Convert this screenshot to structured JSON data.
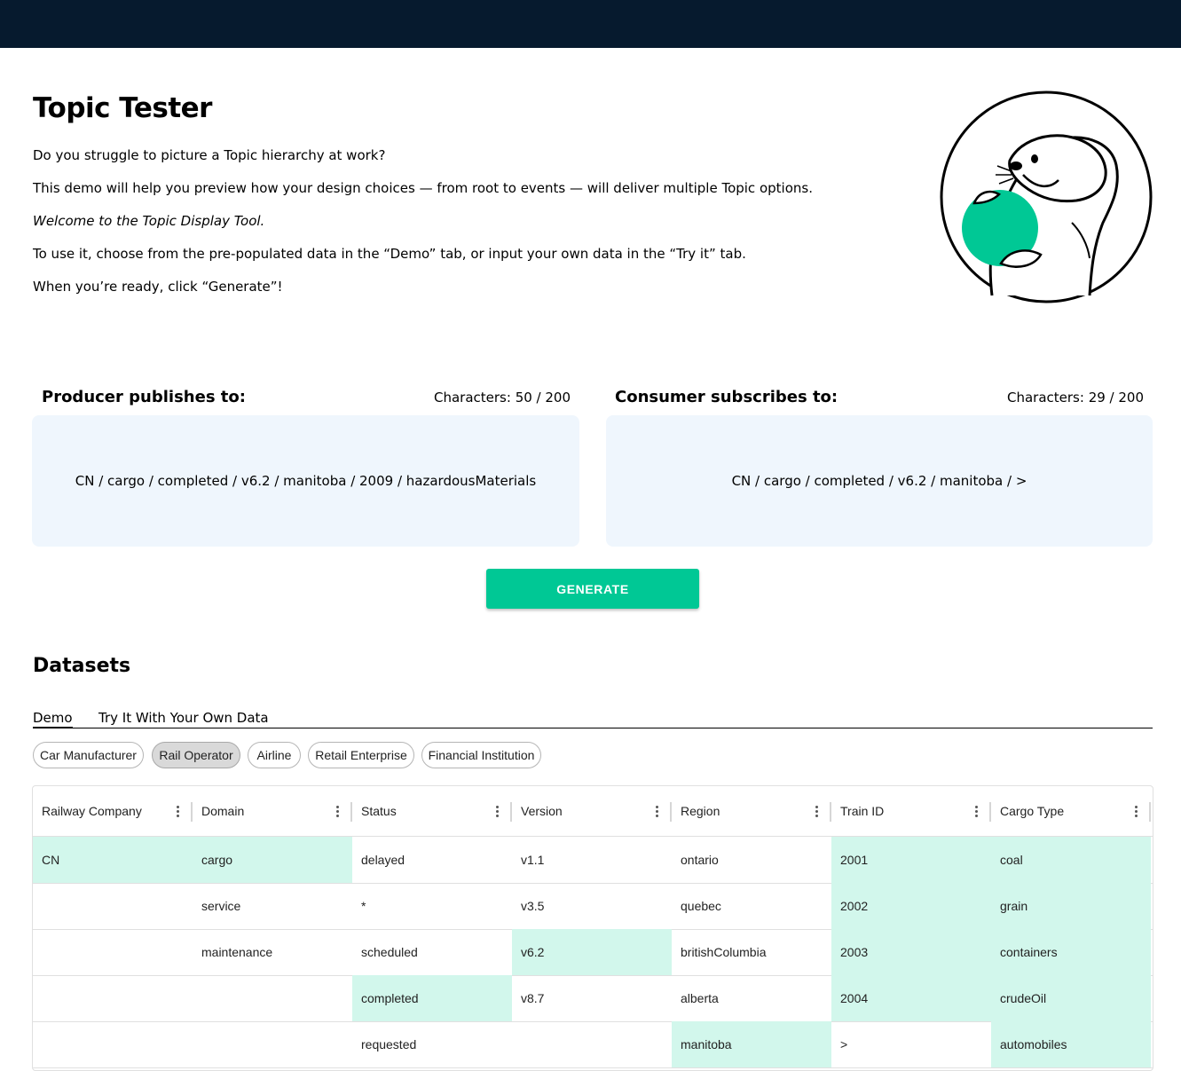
{
  "header": {
    "title": "Topic Tester",
    "paragraphs": [
      "Do you struggle to picture a Topic hierarchy at work?",
      "This demo will help you preview how your design choices — from root to events — will deliver multiple Topic options.",
      "Welcome to the Topic Display Tool.",
      "To use it, choose from the pre-populated data in the “Demo” tab, or input your own data in the “Try it” tab.",
      "When you’re ready, click “Generate”!"
    ]
  },
  "producer": {
    "heading": "Producer publishes to:",
    "chars": "Characters: 50 / 200",
    "topic": "CN / cargo / completed / v6.2 / manitoba / 2009 / hazardousMaterials"
  },
  "consumer": {
    "heading": "Consumer subscribes to:",
    "chars": "Characters: 29 / 200",
    "topic": "CN / cargo / completed / v6.2 / manitoba / >"
  },
  "generate_label": "GENERATE",
  "datasets": {
    "title": "Datasets",
    "tabs": [
      "Demo",
      "Try It With Your Own Data"
    ],
    "active_tab": "Demo",
    "chips": [
      "Car Manufacturer",
      "Rail Operator",
      "Airline",
      "Retail Enterprise",
      "Financial Institution"
    ],
    "selected_chip": "Rail Operator",
    "columns": [
      "Railway Company",
      "Domain",
      "Status",
      "Version",
      "Region",
      "Train ID",
      "Cargo Type"
    ],
    "rows": [
      [
        "CN",
        "cargo",
        "delayed",
        "v1.1",
        "ontario",
        "2001",
        "coal"
      ],
      [
        "",
        "service",
        "*",
        "v3.5",
        "quebec",
        "2002",
        "grain"
      ],
      [
        "",
        "maintenance",
        "scheduled",
        "v6.2",
        "britishColumbia",
        "2003",
        "containers"
      ],
      [
        "",
        "",
        "completed",
        "v8.7",
        "alberta",
        "2004",
        "crudeOil"
      ],
      [
        "",
        "",
        "requested",
        "",
        "manitoba",
        ">",
        "automobiles"
      ]
    ],
    "highlighted": [
      [
        true,
        true,
        false,
        false,
        false,
        true,
        true
      ],
      [
        false,
        false,
        false,
        false,
        false,
        true,
        true
      ],
      [
        false,
        false,
        false,
        true,
        false,
        true,
        true
      ],
      [
        false,
        false,
        true,
        false,
        false,
        true,
        true
      ],
      [
        false,
        false,
        false,
        false,
        true,
        false,
        true
      ]
    ]
  },
  "colors": {
    "topbar": "#061a2e",
    "accent": "#00c895",
    "topic_box_bg": "#eff6fd",
    "highlight_cell": "#d2f7ec"
  }
}
